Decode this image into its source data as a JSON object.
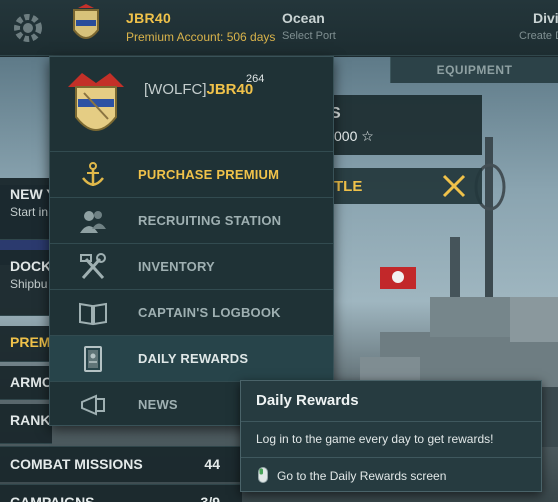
{
  "topbar": {
    "account_name": "JBR40",
    "premium_status": "Premium Account: 506 days",
    "port_title": "Ocean",
    "port_subtitle": "Select Port",
    "division_title": "Divi",
    "division_subtitle": "Create D"
  },
  "tabs": {
    "equipment": "EQUIPMENT"
  },
  "ship_panel": {
    "stats_letter": "S",
    "stats_value": "000 ☆",
    "battle_label": "TLE"
  },
  "left_panel": {
    "new_header": "NEW Y",
    "new_sub": "Start in",
    "dock_header": "DOCK",
    "dock_sub": "Shipbu",
    "prem_header": "PREM",
    "armor_header": "ARMO",
    "ranks_header": "RANKS"
  },
  "bottom_rows": [
    {
      "label": "COMBAT MISSIONS",
      "count": "44"
    },
    {
      "label": "CAMPAIGNS",
      "count": "3/9"
    }
  ],
  "menu": {
    "clan_tag": "[WOLFC]",
    "player": "JBR40",
    "level": "264",
    "items": [
      {
        "label": "PURCHASE PREMIUM",
        "icon": "anchor-icon"
      },
      {
        "label": "RECRUITING STATION",
        "icon": "recruits-icon"
      },
      {
        "label": "INVENTORY",
        "icon": "wrench-hammer-icon"
      },
      {
        "label": "CAPTAIN'S LOGBOOK",
        "icon": "book-icon"
      },
      {
        "label": "DAILY REWARDS",
        "icon": "calendar-icon"
      },
      {
        "label": "NEWS",
        "icon": "megaphone-icon"
      }
    ]
  },
  "tooltip": {
    "title": "Daily Rewards",
    "body": "Log in to the game every day to get rewards!",
    "link": "Go to the Daily Rewards screen"
  },
  "colors": {
    "accent_gold": "#f0c24a",
    "panel_bg": "#1f3236",
    "tooltip_bg": "#263b40"
  }
}
